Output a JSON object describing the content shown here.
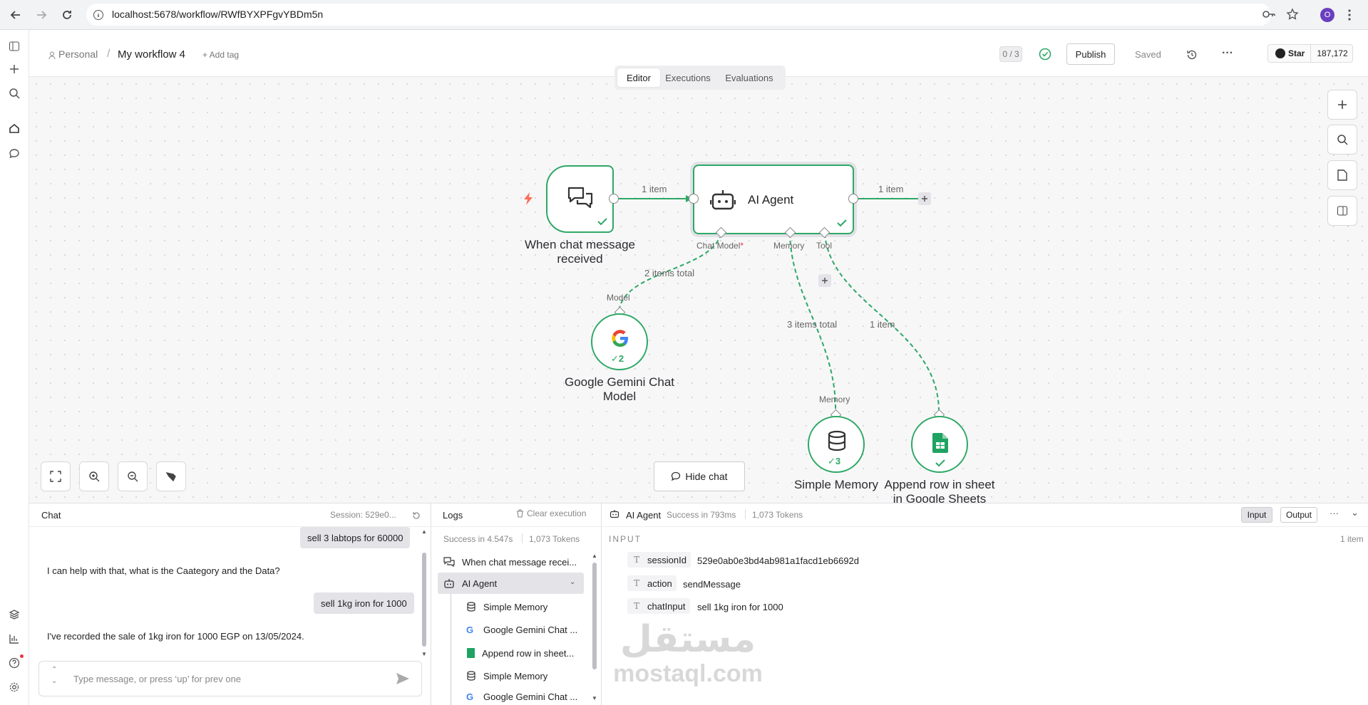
{
  "browser": {
    "url": "localhost:5678/workflow/RWfBYXPFgvYBDm5n",
    "avatar_letter": "O"
  },
  "header": {
    "project": "Personal",
    "separator": "/",
    "workflow_name": "My workflow 4",
    "add_tag": "+ Add tag",
    "progress": "0 / 3",
    "publish": "Publish",
    "saved": "Saved",
    "more": "···",
    "star": "Star",
    "star_count": "187,172"
  },
  "tabs": [
    {
      "label": "Editor",
      "active": true
    },
    {
      "label": "Executions",
      "active": false
    },
    {
      "label": "Evaluations",
      "active": false
    }
  ],
  "nodes": {
    "trigger": "When chat message received",
    "agent": "AI Agent",
    "gemini": "Google Gemini Chat Model",
    "gemini_count": "✓2",
    "memory": "Simple Memory",
    "memory_count": "✓3",
    "sheets": "Append row in sheet in Google Sheets"
  },
  "edges": {
    "trigger_to_agent": "1 item",
    "agent_out": "1 item",
    "model_total": "2 items total",
    "memory_total": "3 items total",
    "tool_items": "1 item"
  },
  "handles": {
    "chat_model": "Chat Model",
    "required_mark": "*",
    "memory": "Memory",
    "tool": "Tool",
    "model": "Model",
    "memory_in": "Memory"
  },
  "hide_chat": "Hide chat",
  "chat": {
    "title": "Chat",
    "session": "Session: 529e0...",
    "messages": [
      {
        "from": "user",
        "text": "sell 3 labtops for 60000"
      },
      {
        "from": "bot",
        "text": "I can help with that, what is the Caategory and the Data?"
      },
      {
        "from": "user",
        "text": "sell 1kg iron for 1000"
      },
      {
        "from": "bot",
        "text": "I've recorded the sale of 1kg iron for 1000 EGP on 13/05/2024."
      }
    ],
    "input_placeholder": "Type message, or press ‘up’ for prev one"
  },
  "logs": {
    "title": "Logs",
    "clear": "Clear execution",
    "summary_status": "Success in 4.547s",
    "summary_tokens": "1,073 Tokens",
    "items": [
      {
        "label": "When chat message recei...",
        "icon": "chat-icon",
        "indent": 0
      },
      {
        "label": "AI Agent",
        "icon": "robot-icon",
        "indent": 0
      },
      {
        "label": "Simple Memory",
        "icon": "database-icon",
        "indent": 1
      },
      {
        "label": "Google Gemini Chat ...",
        "icon": "google-icon",
        "indent": 1
      },
      {
        "label": "Append row in sheet...",
        "icon": "sheets-icon",
        "indent": 1
      },
      {
        "label": "Simple Memory",
        "icon": "database-icon",
        "indent": 1
      },
      {
        "label": "Google Gemini Chat ...",
        "icon": "google-icon",
        "indent": 1
      }
    ]
  },
  "detail": {
    "node": "AI Agent",
    "status": "Success in 793ms",
    "tokens": "1,073 Tokens",
    "input_tab": "Input",
    "output_tab": "Output",
    "section": "INPUT",
    "count": "1 item",
    "fields": [
      {
        "key": "sessionId",
        "value": "529e0ab0e3bd4ab981a1facd1eb6692d"
      },
      {
        "key": "action",
        "value": "sendMessage"
      },
      {
        "key": "chatInput",
        "value": "sell 1kg iron for 1000"
      }
    ]
  },
  "watermark": {
    "arabic": "مستقل",
    "latin": "mostaql.com"
  },
  "colors": {
    "success": "#2ea866",
    "accent": "#ff6d5a"
  }
}
